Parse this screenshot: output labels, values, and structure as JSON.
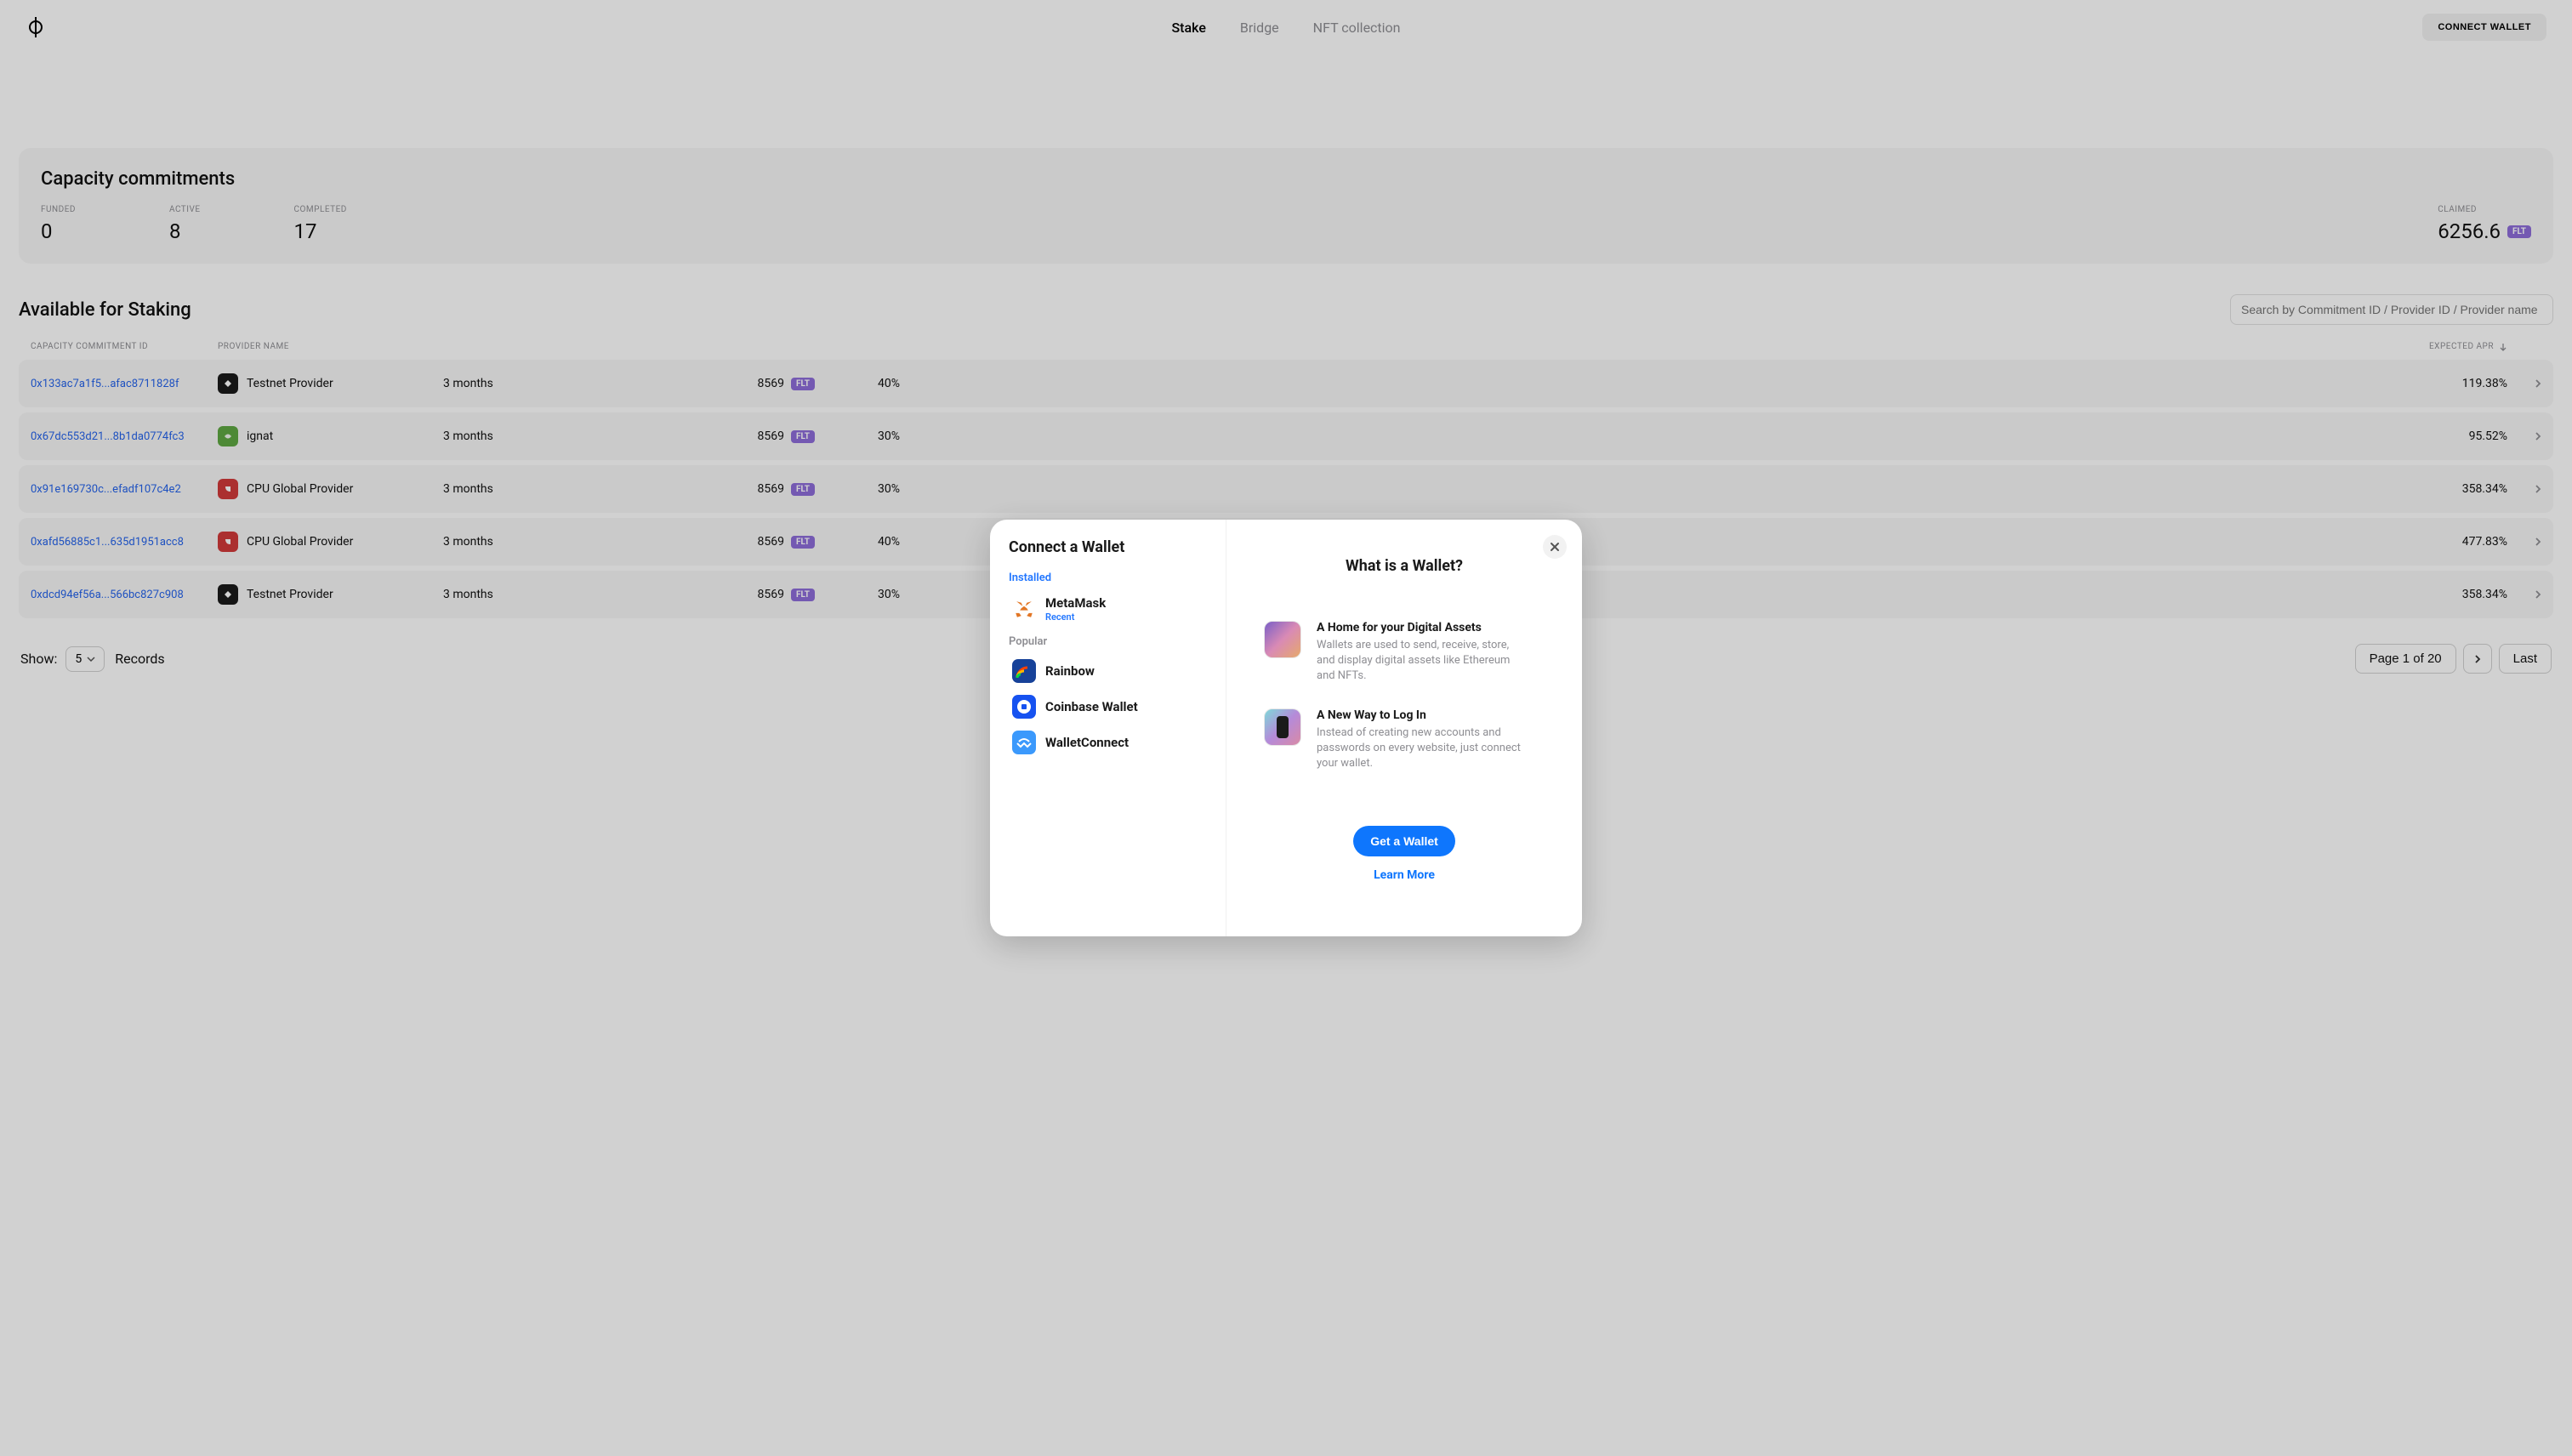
{
  "header": {
    "nav": {
      "stake": "Stake",
      "bridge": "Bridge",
      "nft": "NFT collection"
    },
    "connect": "CONNECT WALLET"
  },
  "stats": {
    "title": "Capacity commitments",
    "funded": {
      "label": "FUNDED",
      "value": "0"
    },
    "active": {
      "label": "ACTIVE",
      "value": "8"
    },
    "completed": {
      "label": "COMPLETED",
      "value": "17"
    },
    "claimed": {
      "label": "CLAIMED",
      "value": "6256.6",
      "unit": "FLT"
    }
  },
  "section": {
    "title": "Available for Staking",
    "search_placeholder": "Search by Commitment ID / Provider ID / Provider name"
  },
  "columns": {
    "id": "CAPACITY COMMITMENT ID",
    "provider": "PROVIDER NAME",
    "apr": "EXPECTED APR"
  },
  "rows": [
    {
      "id": "0x133ac7a1f5...afac8711828f",
      "provider": "Testnet Provider",
      "icon": "black",
      "duration": "3 months",
      "required": "8569",
      "delegate": "40%",
      "apr": "119.38%"
    },
    {
      "id": "0x67dc553d21...8b1da0774fc3",
      "provider": "ignat",
      "icon": "green",
      "duration": "3 months",
      "required": "8569",
      "delegate": "30%",
      "apr": "95.52%"
    },
    {
      "id": "0x91e169730c...efadf107c4e2",
      "provider": "CPU Global Provider",
      "icon": "red",
      "duration": "3 months",
      "required": "8569",
      "delegate": "30%",
      "apr": "358.34%"
    },
    {
      "id": "0xafd56885c1...635d1951acc8",
      "provider": "CPU Global Provider",
      "icon": "red",
      "duration": "3 months",
      "required": "8569",
      "delegate": "40%",
      "apr": "477.83%"
    },
    {
      "id": "0xdcd94ef56a...566bc827c908",
      "provider": "Testnet Provider",
      "icon": "black",
      "duration": "3 months",
      "required": "8569",
      "delegate": "30%",
      "apr": "358.34%"
    }
  ],
  "flt_label": "FLT",
  "pagination": {
    "show": "Show:",
    "count": "5",
    "records": "Records",
    "page_text": "Page 1 of 20",
    "last": "Last"
  },
  "modal": {
    "title": "Connect a Wallet",
    "installed": "Installed",
    "popular": "Popular",
    "metamask": {
      "name": "MetaMask",
      "sub": "Recent"
    },
    "rainbow": "Rainbow",
    "coinbase": "Coinbase Wallet",
    "walletconnect": "WalletConnect",
    "right_title": "What is a Wallet?",
    "info1": {
      "title": "A Home for your Digital Assets",
      "text": "Wallets are used to send, receive, store, and display digital assets like Ethereum and NFTs."
    },
    "info2": {
      "title": "A New Way to Log In",
      "text": "Instead of creating new accounts and passwords on every website, just connect your wallet."
    },
    "get_wallet": "Get a Wallet",
    "learn_more": "Learn More"
  }
}
